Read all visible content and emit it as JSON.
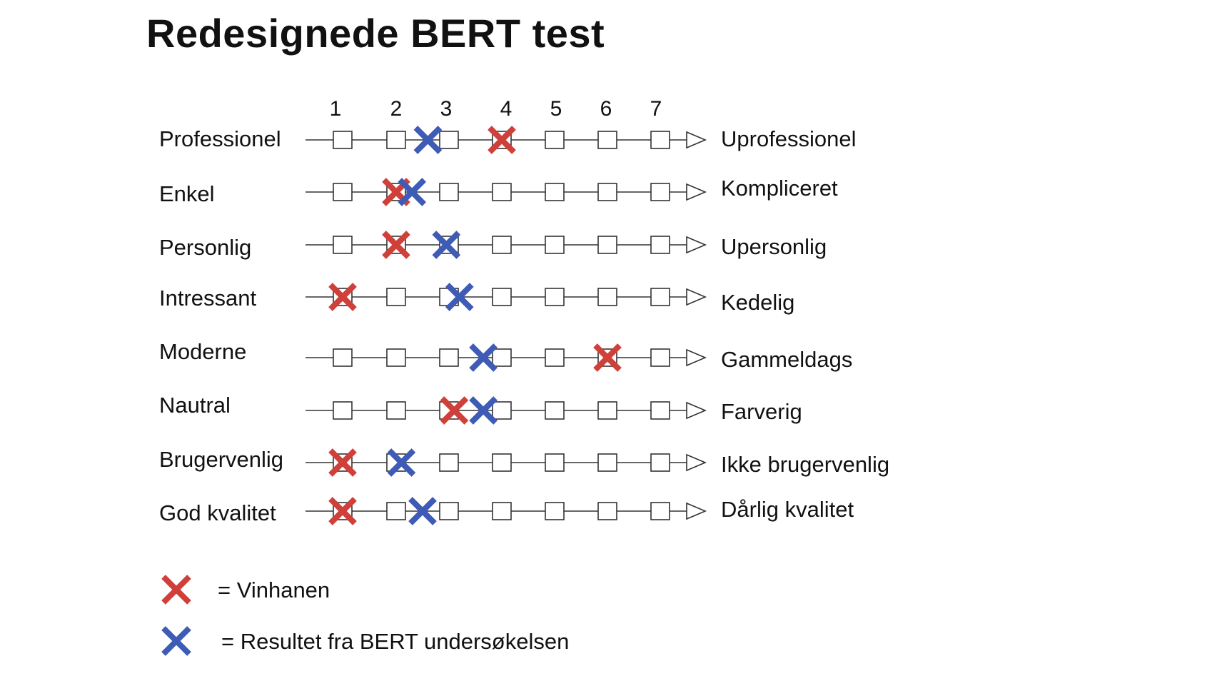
{
  "title": "Redesignede BERT test",
  "scale": [
    "1",
    "2",
    "3",
    "4",
    "5",
    "6",
    "7"
  ],
  "rows": [
    {
      "left": "Professionel",
      "right": "Uprofessionel",
      "red": 4.0,
      "blue": 2.6
    },
    {
      "left": "Enkel",
      "right": "Kompliceret",
      "red": 2.0,
      "blue": 2.3
    },
    {
      "left": "Personlig",
      "right": "Upersonlig",
      "red": 2.0,
      "blue": 2.95
    },
    {
      "left": "Intressant",
      "right": "Kedelig",
      "red": 1.0,
      "blue": 3.2
    },
    {
      "left": "Moderne",
      "right": "Gammeldags",
      "red": 6.0,
      "blue": 3.65
    },
    {
      "left": "Nautral",
      "right": "Farverig",
      "red": 3.1,
      "blue": 3.65
    },
    {
      "left": "Brugervenlig",
      "right": "Ikke brugervenlig",
      "red": 1.0,
      "blue": 2.1
    },
    {
      "left": "God kvalitet",
      "right": "Dårlig kvalitet",
      "red": 1.0,
      "blue": 2.5
    }
  ],
  "legend": [
    {
      "label": "= Vinhanen",
      "color": "#d0403a",
      "icon": "red-x"
    },
    {
      "label": "= Resultet fra BERT undersøkelsen",
      "color": "#3e5bb5",
      "icon": "blue-x"
    }
  ],
  "colors": {
    "red": "#d0403a",
    "blue": "#3e5bb5",
    "line": "#333333"
  }
}
